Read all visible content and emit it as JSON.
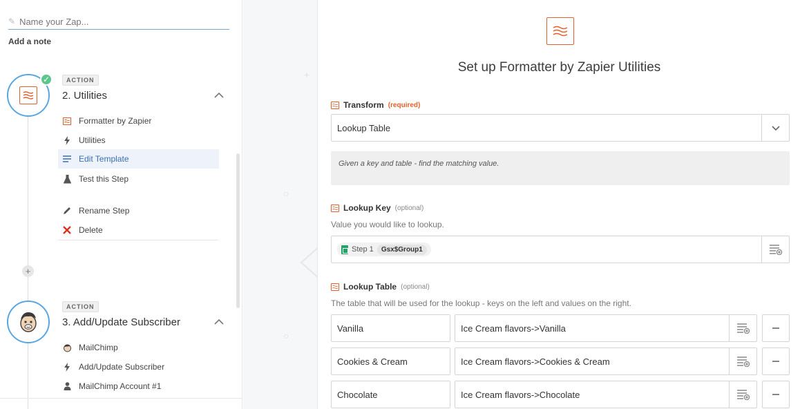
{
  "sidebar": {
    "zap_name_placeholder": "Name your Zap...",
    "add_note": "Add a note",
    "steps": [
      {
        "tag": "ACTION",
        "title": "2. Utilities",
        "items": [
          {
            "label": "Formatter by Zapier",
            "icon": "formatter-icon"
          },
          {
            "label": "Utilities",
            "icon": "bolt-icon"
          },
          {
            "label": "Edit Template",
            "icon": "lines-icon",
            "active": true
          },
          {
            "label": "Test this Step",
            "icon": "flask-icon"
          },
          {
            "label": "Rename Step",
            "icon": "pencil-icon"
          },
          {
            "label": "Delete",
            "icon": "x-icon"
          }
        ]
      },
      {
        "tag": "ACTION",
        "title": "3. Add/Update Subscriber",
        "items": [
          {
            "label": "MailChimp",
            "icon": "mailchimp-icon"
          },
          {
            "label": "Add/Update Subscriber",
            "icon": "bolt-icon"
          },
          {
            "label": "MailChimp Account #1",
            "icon": "user-icon"
          }
        ]
      }
    ]
  },
  "main": {
    "title": "Set up Formatter by Zapier Utilities",
    "transform": {
      "label": "Transform",
      "required": "(required)",
      "value": "Lookup Table",
      "description": "Given a key and table - find the matching value."
    },
    "lookup_key": {
      "label": "Lookup Key",
      "optional": "(optional)",
      "help": "Value you would like to lookup.",
      "pill_step": "Step 1",
      "pill_value": "Gsx$Group1"
    },
    "lookup_table": {
      "label": "Lookup Table",
      "optional": "(optional)",
      "help": "The table that will be used for the lookup - keys on the left and values on the right.",
      "rows": [
        {
          "key": "Vanilla",
          "value": "Ice Cream flavors->Vanilla"
        },
        {
          "key": "Cookies & Cream",
          "value": "Ice Cream flavors->Cookies & Cream"
        },
        {
          "key": "Chocolate",
          "value": "Ice Cream flavors->Chocolate"
        }
      ]
    }
  },
  "colors": {
    "accent_orange": "#e4602b",
    "step_ring_blue": "#5aa6e0",
    "check_green": "#5ec58c",
    "active_blue": "#3a6fb0",
    "delete_red": "#e0301e"
  }
}
